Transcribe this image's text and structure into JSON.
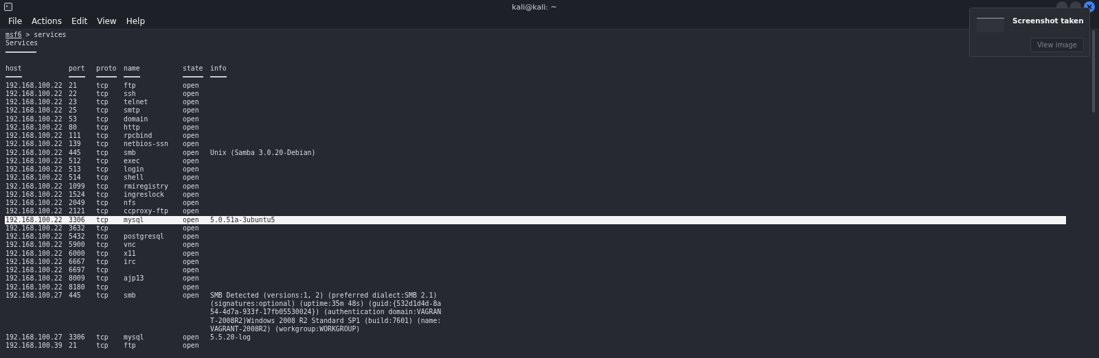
{
  "window": {
    "title": "kali@kali: ~"
  },
  "menu": [
    "File",
    "Actions",
    "Edit",
    "View",
    "Help"
  ],
  "terminal": {
    "prompt": "msf6",
    "command": "> services",
    "heading": "Services",
    "columns": [
      "host",
      "port",
      "proto",
      "name",
      "state",
      "info"
    ],
    "rows": [
      {
        "host": "192.168.100.22",
        "port": "21",
        "proto": "tcp",
        "name": "ftp",
        "state": "open",
        "selected": false
      },
      {
        "host": "192.168.100.22",
        "port": "22",
        "proto": "tcp",
        "name": "ssh",
        "state": "open",
        "selected": false
      },
      {
        "host": "192.168.100.22",
        "port": "23",
        "proto": "tcp",
        "name": "telnet",
        "state": "open",
        "selected": false
      },
      {
        "host": "192.168.100.22",
        "port": "25",
        "proto": "tcp",
        "name": "smtp",
        "state": "open",
        "selected": false
      },
      {
        "host": "192.168.100.22",
        "port": "53",
        "proto": "tcp",
        "name": "domain",
        "state": "open",
        "selected": false
      },
      {
        "host": "192.168.100.22",
        "port": "80",
        "proto": "tcp",
        "name": "http",
        "state": "open",
        "selected": false
      },
      {
        "host": "192.168.100.22",
        "port": "111",
        "proto": "tcp",
        "name": "rpcbind",
        "state": "open",
        "selected": false
      },
      {
        "host": "192.168.100.22",
        "port": "139",
        "proto": "tcp",
        "name": "netbios-ssn",
        "state": "open",
        "selected": false
      },
      {
        "host": "192.168.100.22",
        "port": "445",
        "proto": "tcp",
        "name": "smb",
        "state": "open",
        "info": "Unix (Samba 3.0.20-Debian)",
        "selected": false
      },
      {
        "host": "192.168.100.22",
        "port": "512",
        "proto": "tcp",
        "name": "exec",
        "state": "open",
        "selected": false
      },
      {
        "host": "192.168.100.22",
        "port": "513",
        "proto": "tcp",
        "name": "login",
        "state": "open",
        "selected": false
      },
      {
        "host": "192.168.100.22",
        "port": "514",
        "proto": "tcp",
        "name": "shell",
        "state": "open",
        "selected": false
      },
      {
        "host": "192.168.100.22",
        "port": "1099",
        "proto": "tcp",
        "name": "rmiregistry",
        "state": "open",
        "selected": false
      },
      {
        "host": "192.168.100.22",
        "port": "1524",
        "proto": "tcp",
        "name": "ingreslock",
        "state": "open",
        "selected": false
      },
      {
        "host": "192.168.100.22",
        "port": "2049",
        "proto": "tcp",
        "name": "nfs",
        "state": "open",
        "selected": false
      },
      {
        "host": "192.168.100.22",
        "port": "2121",
        "proto": "tcp",
        "name": "ccproxy-ftp",
        "state": "open",
        "selected": false
      },
      {
        "host": "192.168.100.22",
        "port": "3306",
        "proto": "tcp",
        "name": "mysql",
        "state": "open",
        "info": "5.0.51a-3ubuntu5",
        "selected": true
      },
      {
        "host": "192.168.100.22",
        "port": "3632",
        "proto": "tcp",
        "state": "open",
        "selected": false
      },
      {
        "host": "192.168.100.22",
        "port": "5432",
        "proto": "tcp",
        "name": "postgresql",
        "state": "open",
        "selected": false
      },
      {
        "host": "192.168.100.22",
        "port": "5900",
        "proto": "tcp",
        "name": "vnc",
        "state": "open",
        "selected": false
      },
      {
        "host": "192.168.100.22",
        "port": "6000",
        "proto": "tcp",
        "name": "x11",
        "state": "open",
        "selected": false
      },
      {
        "host": "192.168.100.22",
        "port": "6667",
        "proto": "tcp",
        "name": "irc",
        "state": "open",
        "selected": false
      },
      {
        "host": "192.168.100.22",
        "port": "6697",
        "proto": "tcp",
        "state": "open",
        "selected": false
      },
      {
        "host": "192.168.100.22",
        "port": "8009",
        "proto": "tcp",
        "name": "ajp13",
        "state": "open",
        "selected": false
      },
      {
        "host": "192.168.100.22",
        "port": "8180",
        "proto": "tcp",
        "state": "open",
        "selected": false
      },
      {
        "host": "192.168.100.27",
        "port": "445",
        "proto": "tcp",
        "name": "smb",
        "state": "open",
        "info": "SMB Detected (versions:1, 2) (preferred dialect:SMB 2.1) (signatures:optional) (uptime:35m 48s) (guid:{532d1d4d-8a54-4d7a-933f-17fb05530024}) (authentication domain:VAGRANT-2008R2)Windows 2008 R2 Standard SP1 (build:7601) (name:VAGRANT-2008R2) (workgroup:WORKGROUP)",
        "selected": false
      },
      {
        "host": "192.168.100.27",
        "port": "3306",
        "proto": "tcp",
        "name": "mysql",
        "state": "open",
        "info": "5.5.20-log",
        "selected": false
      },
      {
        "host": "192.168.100.39",
        "port": "21",
        "proto": "tcp",
        "name": "ftp",
        "state": "open",
        "selected": false
      }
    ]
  },
  "notification": {
    "title": "Screenshot taken",
    "button": "View image"
  }
}
